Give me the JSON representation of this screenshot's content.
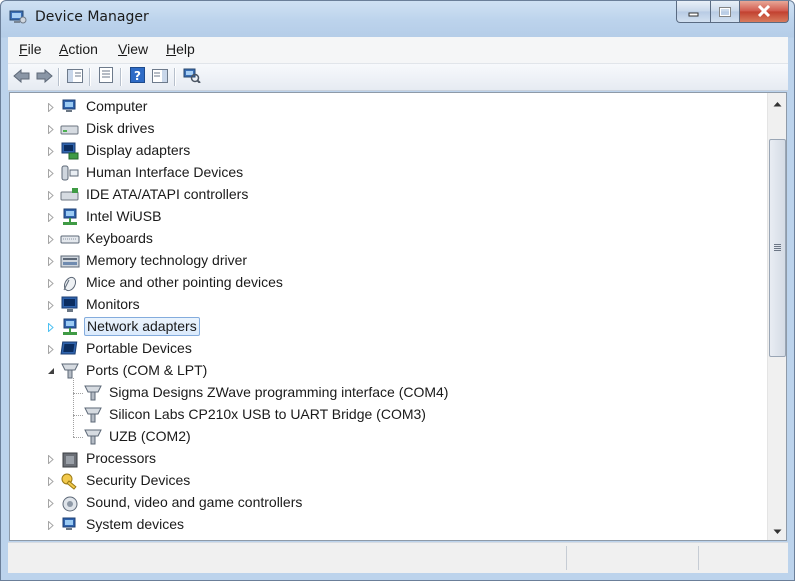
{
  "window": {
    "title": "Device Manager"
  },
  "menu": [
    {
      "label": "File",
      "ul": "F",
      "rest": "ile"
    },
    {
      "label": "Action",
      "ul": "A",
      "rest": "ction"
    },
    {
      "label": "View",
      "ul": "V",
      "rest": "iew"
    },
    {
      "label": "Help",
      "ul": "H",
      "rest": "elp"
    }
  ],
  "toolbar": {
    "buttons": [
      "back-icon",
      "forward-icon",
      "show-hide-console-tree-icon",
      "properties-icon",
      "help-icon",
      "show-hide-action-pane-icon",
      "scan-hardware-changes-icon"
    ]
  },
  "tree": {
    "items": [
      {
        "label": "Computer",
        "expander": "collapsed",
        "icon": "computer-icon",
        "level": 0
      },
      {
        "label": "Disk drives",
        "expander": "collapsed",
        "icon": "disk-drive-icon",
        "level": 0
      },
      {
        "label": "Display adapters",
        "expander": "collapsed",
        "icon": "display-adapter-icon",
        "level": 0
      },
      {
        "label": "Human Interface Devices",
        "expander": "collapsed",
        "icon": "hid-icon",
        "level": 0
      },
      {
        "label": "IDE ATA/ATAPI controllers",
        "expander": "collapsed",
        "icon": "ide-controller-icon",
        "level": 0
      },
      {
        "label": "Intel WiUSB",
        "expander": "collapsed",
        "icon": "network-icon",
        "level": 0
      },
      {
        "label": "Keyboards",
        "expander": "collapsed",
        "icon": "keyboard-icon",
        "level": 0
      },
      {
        "label": "Memory technology driver",
        "expander": "collapsed",
        "icon": "memory-icon",
        "level": 0
      },
      {
        "label": "Mice and other pointing devices",
        "expander": "collapsed",
        "icon": "mouse-icon",
        "level": 0
      },
      {
        "label": "Monitors",
        "expander": "collapsed",
        "icon": "monitor-icon",
        "level": 0
      },
      {
        "label": "Network adapters",
        "expander": "collapsed-hover",
        "icon": "network-adapter-icon",
        "level": 0,
        "selected": true
      },
      {
        "label": "Portable Devices",
        "expander": "collapsed",
        "icon": "portable-device-icon",
        "level": 0
      },
      {
        "label": "Ports (COM & LPT)",
        "expander": "expanded",
        "icon": "port-icon",
        "level": 0
      },
      {
        "label": "Sigma Designs ZWave programming interface (COM4)",
        "expander": "none",
        "icon": "port-icon",
        "level": 1
      },
      {
        "label": "Silicon Labs CP210x USB to UART Bridge (COM3)",
        "expander": "none",
        "icon": "port-icon",
        "level": 1
      },
      {
        "label": "UZB (COM2)",
        "expander": "none",
        "icon": "port-icon",
        "level": 1
      },
      {
        "label": "Processors",
        "expander": "collapsed",
        "icon": "processor-icon",
        "level": 0
      },
      {
        "label": "Security Devices",
        "expander": "collapsed",
        "icon": "security-key-icon",
        "level": 0
      },
      {
        "label": "Sound, video and game controllers",
        "expander": "collapsed",
        "icon": "sound-icon",
        "level": 0
      },
      {
        "label": "System devices",
        "expander": "collapsed",
        "icon": "system-device-icon",
        "level": 0
      }
    ]
  },
  "colors": {
    "selection_border": "#84acdd",
    "selection_fill": "#dbeafc",
    "close_red": "#c1402f"
  }
}
